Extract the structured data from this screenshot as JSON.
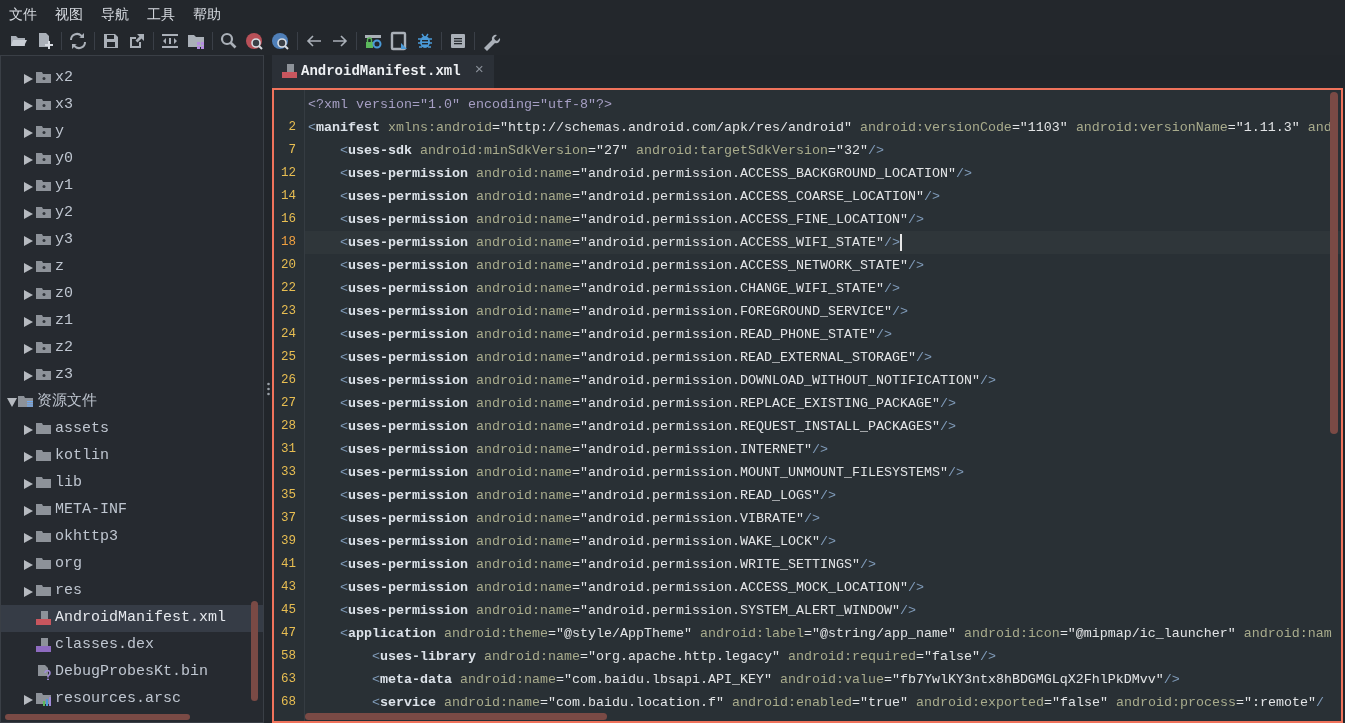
{
  "menu": [
    {
      "label": "文件"
    },
    {
      "label": "视图"
    },
    {
      "label": "导航"
    },
    {
      "label": "工具"
    },
    {
      "label": "帮助"
    }
  ],
  "tree": [
    {
      "children": [
        {
          "label": "x2",
          "kind": "package",
          "expanded": false,
          "selected": false
        },
        {
          "label": "x3",
          "kind": "package",
          "expanded": false,
          "selected": false
        },
        {
          "label": "y",
          "kind": "package",
          "expanded": false,
          "selected": false
        },
        {
          "label": "y0",
          "kind": "package",
          "expanded": false,
          "selected": false
        },
        {
          "label": "y1",
          "kind": "package",
          "expanded": false,
          "selected": false
        },
        {
          "label": "y2",
          "kind": "package",
          "expanded": false,
          "selected": false
        },
        {
          "label": "y3",
          "kind": "package",
          "expanded": false,
          "selected": false
        },
        {
          "label": "z",
          "kind": "package",
          "expanded": false,
          "selected": false
        },
        {
          "label": "z0",
          "kind": "package",
          "expanded": false,
          "selected": false
        },
        {
          "label": "z1",
          "kind": "package",
          "expanded": false,
          "selected": false
        },
        {
          "label": "z2",
          "kind": "package",
          "expanded": false,
          "selected": false
        },
        {
          "label": "z3",
          "kind": "package",
          "expanded": false,
          "selected": false
        }
      ]
    },
    {
      "label": "资源文件",
      "kind": "resources",
      "expanded": true,
      "selected": false,
      "children": [
        {
          "label": "assets",
          "kind": "folder",
          "expanded": false,
          "selected": false
        },
        {
          "label": "kotlin",
          "kind": "folder",
          "expanded": false,
          "selected": false
        },
        {
          "label": "lib",
          "kind": "folder",
          "expanded": false,
          "selected": false
        },
        {
          "label": "META-INF",
          "kind": "folder",
          "expanded": false,
          "selected": false
        },
        {
          "label": "okhttp3",
          "kind": "folder",
          "expanded": false,
          "selected": false
        },
        {
          "label": "org",
          "kind": "folder",
          "expanded": false,
          "selected": false
        },
        {
          "label": "res",
          "kind": "folder",
          "expanded": false,
          "selected": false
        },
        {
          "label": "AndroidManifest.xml",
          "kind": "manifest",
          "selected": true
        },
        {
          "label": "classes.dex",
          "kind": "dex",
          "selected": false
        },
        {
          "label": "DebugProbesKt.bin",
          "kind": "unknown",
          "selected": false
        },
        {
          "label": "resources.arsc",
          "kind": "arsc",
          "expanded": false,
          "selected": false
        }
      ]
    }
  ],
  "tabs": [
    {
      "label": "AndroidManifest.xml",
      "close": "×",
      "selected": true
    }
  ],
  "code": [
    {
      "declaration": "<?xml version=\"1.0\" encoding=\"utf-8\"?>",
      "current": false
    },
    {
      "number": "2",
      "open": "<",
      "tag": "manifest",
      "attributes": [
        {
          "name": "xmlns:android",
          "value": "=\"http://schemas.android.com/apk/res/android\""
        },
        {
          "name": "android:versionCode",
          "value": "=\"1103\""
        },
        {
          "name": "android:versionName",
          "value": "=\"1.11.3\""
        },
        {
          "name": "and"
        }
      ],
      "current": false,
      "children": [
        {
          "number": "7",
          "open": "<",
          "tag": "uses-sdk",
          "attributes": [
            {
              "name": "android:minSdkVersion",
              "value": "=\"27\""
            },
            {
              "name": "android:targetSdkVersion",
              "value": "=\"32\""
            }
          ],
          "close": "/>",
          "current": false
        },
        {
          "number": "12",
          "open": "<",
          "tag": "uses-permission",
          "attributes": [
            {
              "name": "android:name",
              "value": "=\"android.permission.ACCESS_BACKGROUND_LOCATION\""
            }
          ],
          "close": "/>",
          "current": false
        },
        {
          "number": "14",
          "open": "<",
          "tag": "uses-permission",
          "attributes": [
            {
              "name": "android:name",
              "value": "=\"android.permission.ACCESS_COARSE_LOCATION\""
            }
          ],
          "close": "/>",
          "current": false
        },
        {
          "number": "16",
          "open": "<",
          "tag": "uses-permission",
          "attributes": [
            {
              "name": "android:name",
              "value": "=\"android.permission.ACCESS_FINE_LOCATION\""
            }
          ],
          "close": "/>",
          "current": false
        },
        {
          "number": "18",
          "open": "<",
          "tag": "uses-permission",
          "attributes": [
            {
              "name": "android:name",
              "value": "=\"android.permission.ACCESS_WIFI_STATE\""
            }
          ],
          "close": "/>",
          "current": true
        },
        {
          "number": "20",
          "open": "<",
          "tag": "uses-permission",
          "attributes": [
            {
              "name": "android:name",
              "value": "=\"android.permission.ACCESS_NETWORK_STATE\""
            }
          ],
          "close": "/>",
          "current": false
        },
        {
          "number": "22",
          "open": "<",
          "tag": "uses-permission",
          "attributes": [
            {
              "name": "android:name",
              "value": "=\"android.permission.CHANGE_WIFI_STATE\""
            }
          ],
          "close": "/>",
          "current": false
        },
        {
          "number": "23",
          "open": "<",
          "tag": "uses-permission",
          "attributes": [
            {
              "name": "android:name",
              "value": "=\"android.permission.FOREGROUND_SERVICE\""
            }
          ],
          "close": "/>",
          "current": false
        },
        {
          "number": "24",
          "open": "<",
          "tag": "uses-permission",
          "attributes": [
            {
              "name": "android:name",
              "value": "=\"android.permission.READ_PHONE_STATE\""
            }
          ],
          "close": "/>",
          "current": false
        },
        {
          "number": "25",
          "open": "<",
          "tag": "uses-permission",
          "attributes": [
            {
              "name": "android:name",
              "value": "=\"android.permission.READ_EXTERNAL_STORAGE\""
            }
          ],
          "close": "/>",
          "current": false
        },
        {
          "number": "26",
          "open": "<",
          "tag": "uses-permission",
          "attributes": [
            {
              "name": "android:name",
              "value": "=\"android.permission.DOWNLOAD_WITHOUT_NOTIFICATION\""
            }
          ],
          "close": "/>",
          "current": false
        },
        {
          "number": "27",
          "open": "<",
          "tag": "uses-permission",
          "attributes": [
            {
              "name": "android:name",
              "value": "=\"android.permission.REPLACE_EXISTING_PACKAGE\""
            }
          ],
          "close": "/>",
          "current": false
        },
        {
          "number": "28",
          "open": "<",
          "tag": "uses-permission",
          "attributes": [
            {
              "name": "android:name",
              "value": "=\"android.permission.REQUEST_INSTALL_PACKAGES\""
            }
          ],
          "close": "/>",
          "current": false
        },
        {
          "number": "31",
          "open": "<",
          "tag": "uses-permission",
          "attributes": [
            {
              "name": "android:name",
              "value": "=\"android.permission.INTERNET\""
            }
          ],
          "close": "/>",
          "current": false
        },
        {
          "number": "33",
          "open": "<",
          "tag": "uses-permission",
          "attributes": [
            {
              "name": "android:name",
              "value": "=\"android.permission.MOUNT_UNMOUNT_FILESYSTEMS\""
            }
          ],
          "close": "/>",
          "current": false
        },
        {
          "number": "35",
          "open": "<",
          "tag": "uses-permission",
          "attributes": [
            {
              "name": "android:name",
              "value": "=\"android.permission.READ_LOGS\""
            }
          ],
          "close": "/>",
          "current": false
        },
        {
          "number": "37",
          "open": "<",
          "tag": "uses-permission",
          "attributes": [
            {
              "name": "android:name",
              "value": "=\"android.permission.VIBRATE\""
            }
          ],
          "close": "/>",
          "current": false
        },
        {
          "number": "39",
          "open": "<",
          "tag": "uses-permission",
          "attributes": [
            {
              "name": "android:name",
              "value": "=\"android.permission.WAKE_LOCK\""
            }
          ],
          "close": "/>",
          "current": false
        },
        {
          "number": "41",
          "open": "<",
          "tag": "uses-permission",
          "attributes": [
            {
              "name": "android:name",
              "value": "=\"android.permission.WRITE_SETTINGS\""
            }
          ],
          "close": "/>",
          "current": false
        },
        {
          "number": "43",
          "open": "<",
          "tag": "uses-permission",
          "attributes": [
            {
              "name": "android:name",
              "value": "=\"android.permission.ACCESS_MOCK_LOCATION\""
            }
          ],
          "close": "/>",
          "current": false
        },
        {
          "number": "45",
          "open": "<",
          "tag": "uses-permission",
          "attributes": [
            {
              "name": "android:name",
              "value": "=\"android.permission.SYSTEM_ALERT_WINDOW\""
            }
          ],
          "close": "/>",
          "current": false
        },
        {
          "number": "47",
          "open": "<",
          "tag": "application",
          "attributes": [
            {
              "name": "android:theme",
              "value": "=\"@style/AppTheme\""
            },
            {
              "name": "android:label",
              "value": "=\"@string/app_name\""
            },
            {
              "name": "android:icon",
              "value": "=\"@mipmap/ic_launcher\""
            },
            {
              "name": "android:nam"
            }
          ],
          "current": false,
          "children": [
            {
              "number": "58",
              "open": "<",
              "tag": "uses-library",
              "attributes": [
                {
                  "name": "android:name",
                  "value": "=\"org.apache.http.legacy\""
                },
                {
                  "name": "android:required",
                  "value": "=\"false\""
                }
              ],
              "close": "/>",
              "current": false
            },
            {
              "number": "63",
              "open": "<",
              "tag": "meta-data",
              "attributes": [
                {
                  "name": "android:name",
                  "value": "=\"com.baidu.lbsapi.API_KEY\""
                },
                {
                  "name": "android:value",
                  "value": "=\"fb7YwlKY3ntx8hBDGMGLqX2FhlPkDMvv\""
                }
              ],
              "close": "/>",
              "current": false
            },
            {
              "number": "68",
              "open": "<",
              "tag": "service",
              "attributes": [
                {
                  "name": "android:name",
                  "value": "=\"com.baidu.location.f\""
                },
                {
                  "name": "android:enabled",
                  "value": "=\"true\""
                },
                {
                  "name": "android:exported",
                  "value": "=\"false\""
                },
                {
                  "name": "android:process",
                  "value": "=\":remote\""
                }
              ],
              "close": "/",
              "current": false
            }
          ]
        }
      ]
    }
  ]
}
